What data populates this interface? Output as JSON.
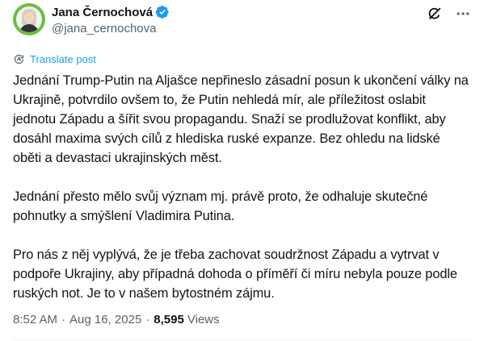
{
  "author": {
    "display_name": "Jana Černochová",
    "handle": "@jana_cernochova",
    "verified": true
  },
  "header_icons": {
    "grok": "grok-icon",
    "more": "more-icon"
  },
  "translate": {
    "icon": "translate-icon",
    "label": "Translate post"
  },
  "post": {
    "paragraphs": [
      "Jednání Trump-Putin na Aljašce nepřineslo zásadní posun k ukončení války na Ukrajině, potvrdilo ovšem to, že Putin nehledá mír, ale příležitost oslabit jednotu Západu a šířit svou propagandu. Snaží se prodlužovat konflikt, aby dosáhl maxima svých cílů z hlediska ruské expanze. Bez ohledu na lidské oběti a devastaci ukrajinských měst.",
      "Jednání přesto mělo svůj význam mj. právě proto, že odhaluje skutečné pohnutky a smýšlení Vladimira Putina.",
      "Pro nás z něj vyplývá, že je třeba zachovat soudržnost Západu a vytrvat v podpoře Ukrajiny, aby případná dohoda o příměří či míru nebyla pouze podle ruských not. Je to v našem bytostném zájmu."
    ]
  },
  "meta": {
    "time": "8:52 AM",
    "separator": "·",
    "date": "Aug 16, 2025",
    "views_count": "8,595",
    "views_label": "Views"
  },
  "colors": {
    "accent": "#1d9bf0",
    "secondary_text": "#536471",
    "primary_text": "#0f1419",
    "avatar_ring": "#6dbf3f"
  }
}
